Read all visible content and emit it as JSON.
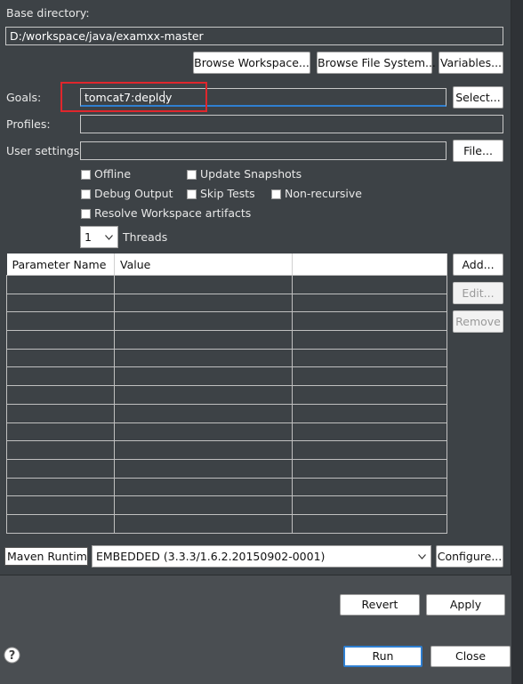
{
  "base_directory": {
    "label": "Base directory:",
    "value": "D:/workspace/java/examxx-master"
  },
  "base_buttons": {
    "browse_workspace": "Browse Workspace...",
    "browse_file_system": "Browse File System...",
    "variables": "Variables..."
  },
  "goals": {
    "label": "Goals:",
    "value": "tomcat7:deploy",
    "select": "Select..."
  },
  "profiles": {
    "label": "Profiles:",
    "value": ""
  },
  "user_settings": {
    "label": "User settings:",
    "value": "",
    "file": "File..."
  },
  "options": {
    "offline": "Offline",
    "update_snapshots": "Update Snapshots",
    "debug_output": "Debug Output",
    "skip_tests": "Skip Tests",
    "non_recursive": "Non-recursive",
    "resolve_workspace": "Resolve Workspace artifacts"
  },
  "threads": {
    "value": "1",
    "label": "Threads"
  },
  "params_table": {
    "columns": [
      "Parameter Name",
      "Value",
      ""
    ],
    "row_count": 14
  },
  "param_buttons": {
    "add": "Add...",
    "edit": "Edit...",
    "remove": "Remove"
  },
  "maven_runtime": {
    "label": "Maven Runtime:",
    "value": "EMBEDDED (3.3.3/1.6.2.20150902-0001)",
    "configure": "Configure..."
  },
  "footer": {
    "revert": "Revert",
    "apply": "Apply",
    "run": "Run",
    "close": "Close",
    "help_icon": "question-circle-icon"
  },
  "colors": {
    "panel_bg": "#3d4246",
    "outer_bg": "#4a4e52",
    "highlight": "#e0262c",
    "focus_underline": "#2f7fd1"
  }
}
